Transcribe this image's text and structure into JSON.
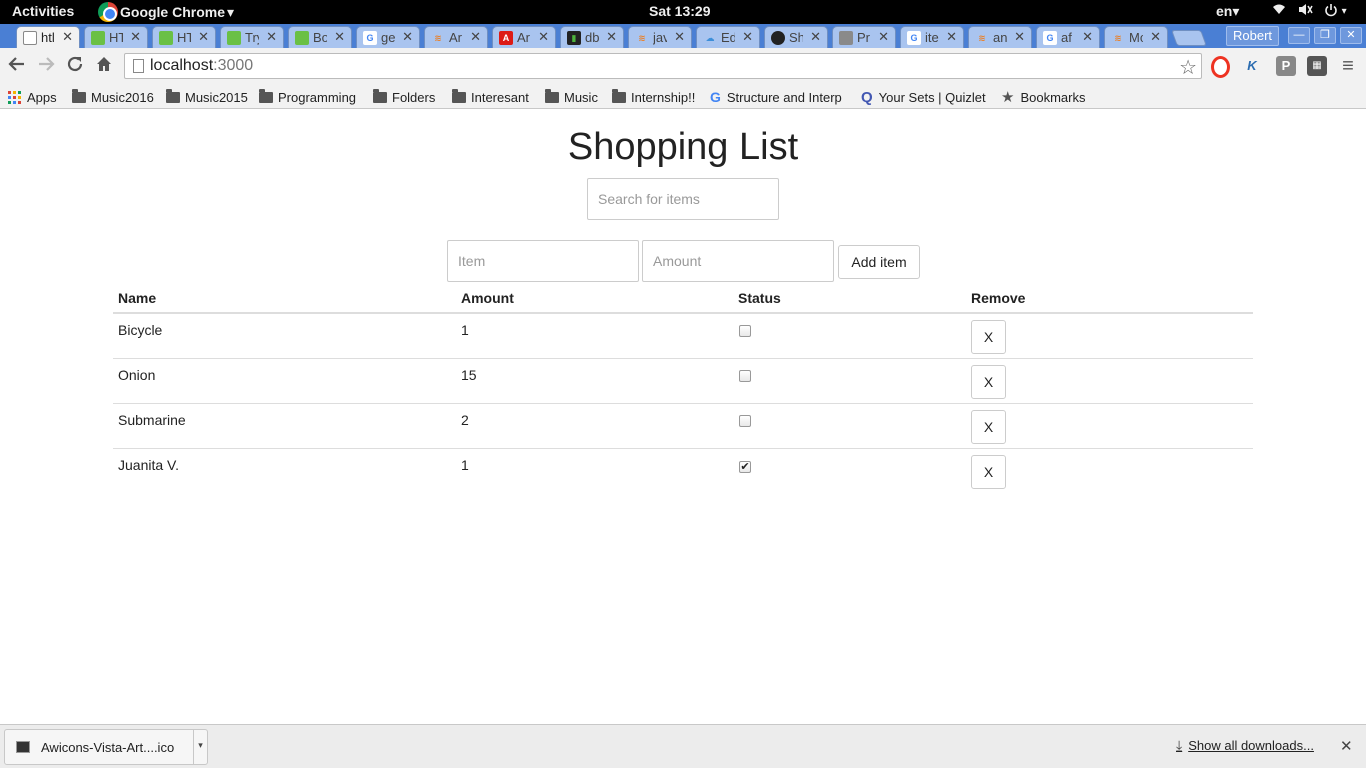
{
  "topbar": {
    "activities": "Activities",
    "app_name": "Google Chrome",
    "app_menu_arrow": "▾",
    "clock": "Sat 13:29",
    "language": "en",
    "language_arrow": "▾"
  },
  "browser": {
    "tabs": [
      {
        "title": "htl",
        "favicon": "page-icon",
        "active": true
      },
      {
        "title": "HT",
        "favicon": "w3schools-icon"
      },
      {
        "title": "HT",
        "favicon": "w3schools-icon"
      },
      {
        "title": "Try",
        "favicon": "w3schools-icon"
      },
      {
        "title": "Bo",
        "favicon": "w3schools-icon"
      },
      {
        "title": "ge",
        "favicon": "google-icon"
      },
      {
        "title": "Ar",
        "favicon": "stackoverflow-icon"
      },
      {
        "title": "Ar",
        "favicon": "angular-icon"
      },
      {
        "title": "db",
        "favicon": "mongodb-icon"
      },
      {
        "title": "jav",
        "favicon": "stackoverflow-icon"
      },
      {
        "title": "Ed",
        "favicon": "cloud-icon"
      },
      {
        "title": "Sh",
        "favicon": "github-icon"
      },
      {
        "title": "Pr",
        "favicon": "profile-icon"
      },
      {
        "title": "ite",
        "favicon": "google-icon"
      },
      {
        "title": "an",
        "favicon": "stackoverflow-icon"
      },
      {
        "title": "af",
        "favicon": "google-icon"
      },
      {
        "title": "Mc",
        "favicon": "stackoverflow-icon"
      }
    ],
    "tab_close_glyph": "✕",
    "profile_name": "Robert",
    "url_host": "localhost",
    "url_port": ":3000"
  },
  "bookmarks": [
    {
      "label": "Apps",
      "icon": "apps-grid-icon"
    },
    {
      "label": "Music2016",
      "icon": "folder-icon"
    },
    {
      "label": "Music2015",
      "icon": "folder-icon"
    },
    {
      "label": "Programming",
      "icon": "folder-icon"
    },
    {
      "label": "Folders",
      "icon": "folder-icon"
    },
    {
      "label": "Interesant",
      "icon": "folder-icon"
    },
    {
      "label": "Music",
      "icon": "folder-icon"
    },
    {
      "label": "Internship!!",
      "icon": "folder-icon"
    },
    {
      "label": "Structure and Interp",
      "icon": "google-icon"
    },
    {
      "label": "Your Sets | Quizlet",
      "icon": "quizlet-icon"
    },
    {
      "label": "Bookmarks",
      "icon": "star-icon"
    }
  ],
  "app": {
    "title": "Shopping List",
    "search_placeholder": "Search for items",
    "item_placeholder": "Item",
    "amount_placeholder": "Amount",
    "add_button_label": "Add item",
    "columns": {
      "name": "Name",
      "amount": "Amount",
      "status": "Status",
      "remove": "Remove"
    },
    "remove_label": "X",
    "items": [
      {
        "name": "Bicycle",
        "amount": "1",
        "done": false
      },
      {
        "name": "Onion",
        "amount": "15",
        "done": false
      },
      {
        "name": "Submarine",
        "amount": "2",
        "done": false
      },
      {
        "name": "Juanita V.",
        "amount": "1",
        "done": true
      }
    ]
  },
  "downloads": {
    "file_name": "Awicons-Vista-Art....ico",
    "show_all_label": "Show all downloads...",
    "close_glyph": "✕"
  },
  "colors": {
    "tabstrip": "#4a7fd4",
    "toolbar": "#f2f2f2"
  }
}
